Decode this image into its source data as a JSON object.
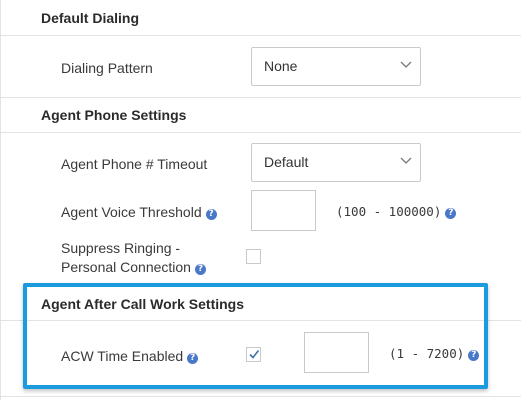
{
  "default_dialing": {
    "title": "Default Dialing",
    "dialing_pattern": {
      "label": "Dialing Pattern",
      "value": "None"
    }
  },
  "agent_phone_settings": {
    "title": "Agent Phone Settings",
    "phone_timeout": {
      "label": "Agent Phone # Timeout",
      "value": "Default"
    },
    "voice_threshold": {
      "label": "Agent Voice Threshold",
      "value": "",
      "range": "(100 - 100000)"
    },
    "suppress_ringing": {
      "label_line1": "Suppress Ringing -",
      "label_line2": "Personal Connection",
      "checked": false
    }
  },
  "acw_settings": {
    "title": "Agent After Call Work Settings",
    "acw_time": {
      "label": "ACW Time Enabled",
      "checked": true,
      "value": "",
      "range": "(1 - 7200)"
    }
  },
  "colors": {
    "highlight": "#1a9be0",
    "info_icon": "#4a78c8"
  },
  "icons": {
    "info": "info-icon",
    "dropdown": "chevron-down-icon",
    "check": "checkmark-icon"
  }
}
